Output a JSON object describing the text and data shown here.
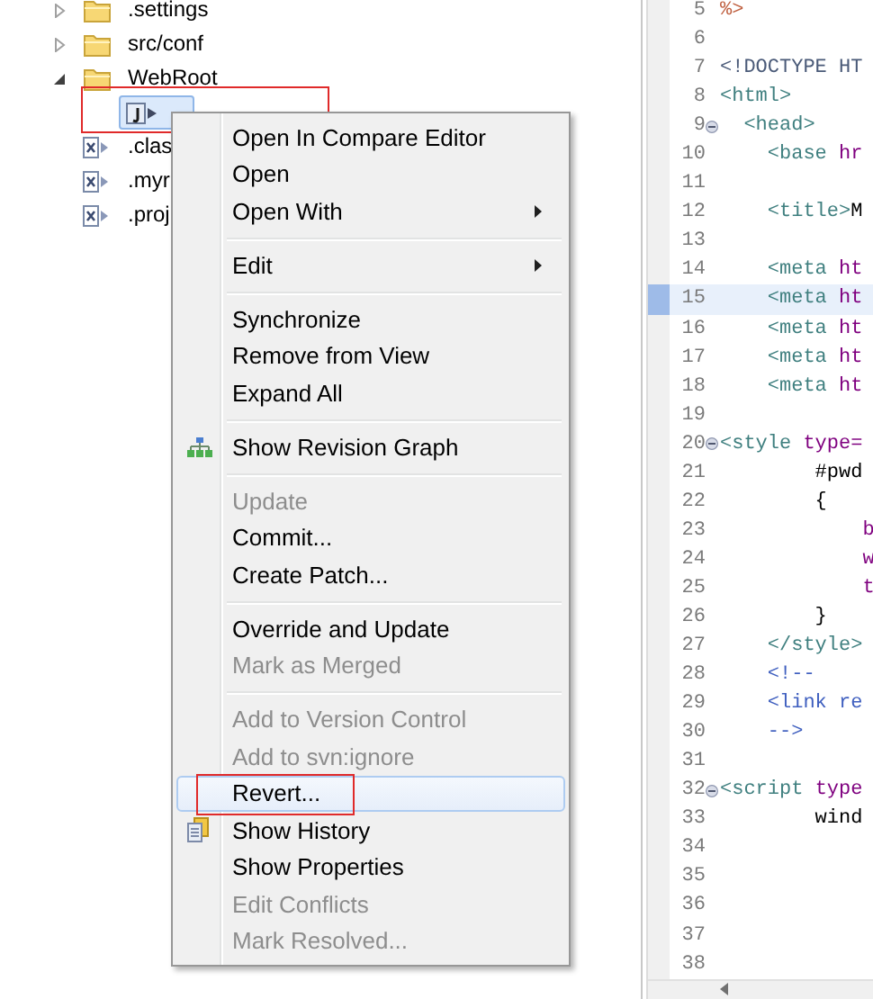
{
  "tree": {
    "items": [
      {
        "label": ".settings",
        "kind": "folder",
        "expanded": false,
        "selected": false
      },
      {
        "label": "src/conf",
        "kind": "folder",
        "expanded": false,
        "selected": false
      },
      {
        "label": "WebRoot",
        "kind": "folder",
        "expanded": true,
        "selected": false,
        "children": [
          {
            "kind": "jsp",
            "selected": true,
            "marked": true
          }
        ]
      },
      {
        "label": ".clas",
        "kind": "xml",
        "selected": false
      },
      {
        "label": ".myr",
        "kind": "xml",
        "selected": false
      },
      {
        "label": ".proj",
        "kind": "xml",
        "selected": false
      }
    ]
  },
  "context_menu": {
    "groups": [
      [
        {
          "label": "Open In Compare Editor",
          "kind": "plain",
          "disabled": false,
          "submenu": false,
          "highlighted": false,
          "marked": false
        },
        {
          "label": "Open",
          "kind": "plain",
          "disabled": false,
          "submenu": false,
          "highlighted": false,
          "marked": false
        },
        {
          "label": "Open With",
          "kind": "plain",
          "disabled": false,
          "submenu": true,
          "highlighted": false,
          "marked": false
        }
      ],
      [
        {
          "label": "Edit",
          "kind": "plain",
          "disabled": false,
          "submenu": true,
          "highlighted": false,
          "marked": false
        }
      ],
      [
        {
          "label": "Synchronize",
          "kind": "plain",
          "disabled": false,
          "submenu": false,
          "highlighted": false,
          "marked": false
        },
        {
          "label": "Remove from View",
          "kind": "plain",
          "disabled": false,
          "submenu": false,
          "highlighted": false,
          "marked": false
        },
        {
          "label": "Expand All",
          "kind": "plain",
          "disabled": false,
          "submenu": false,
          "highlighted": false,
          "marked": false
        }
      ],
      [
        {
          "label": "Show Revision Graph",
          "kind": "graph",
          "disabled": false,
          "submenu": false,
          "highlighted": false,
          "marked": false
        }
      ],
      [
        {
          "label": "Update",
          "kind": "plain",
          "disabled": true,
          "submenu": false,
          "highlighted": false,
          "marked": false
        },
        {
          "label": "Commit...",
          "kind": "plain",
          "disabled": false,
          "submenu": false,
          "highlighted": false,
          "marked": false
        },
        {
          "label": "Create Patch...",
          "kind": "plain",
          "disabled": false,
          "submenu": false,
          "highlighted": false,
          "marked": false
        }
      ],
      [
        {
          "label": "Override and Update",
          "kind": "plain",
          "disabled": false,
          "submenu": false,
          "highlighted": false,
          "marked": false
        },
        {
          "label": "Mark as Merged",
          "kind": "plain",
          "disabled": true,
          "submenu": false,
          "highlighted": false,
          "marked": false
        }
      ],
      [
        {
          "label": "Add to Version Control",
          "kind": "plain",
          "disabled": true,
          "submenu": false,
          "highlighted": false,
          "marked": false
        },
        {
          "label": "Add to svn:ignore",
          "kind": "plain",
          "disabled": true,
          "submenu": false,
          "highlighted": false,
          "marked": false
        },
        {
          "label": "Revert...",
          "kind": "plain",
          "disabled": false,
          "submenu": false,
          "highlighted": true,
          "marked": true
        },
        {
          "label": "Show History",
          "kind": "history",
          "disabled": false,
          "submenu": false,
          "highlighted": false,
          "marked": false
        },
        {
          "label": "Show Properties",
          "kind": "plain",
          "disabled": false,
          "submenu": false,
          "highlighted": false,
          "marked": false
        },
        {
          "label": "Edit Conflicts",
          "kind": "plain",
          "disabled": true,
          "submenu": false,
          "highlighted": false,
          "marked": false
        },
        {
          "label": "Mark Resolved...",
          "kind": "plain",
          "disabled": true,
          "submenu": false,
          "highlighted": false,
          "marked": false
        }
      ]
    ]
  },
  "editor": {
    "lines": [
      {
        "number": "5",
        "current": false,
        "foldable": false,
        "tokens": [
          {
            "text": "%>",
            "kind": "scriptlet"
          }
        ]
      },
      {
        "number": "6",
        "current": false,
        "foldable": false
      },
      {
        "number": "7",
        "current": false,
        "foldable": false,
        "tokens": [
          {
            "text": "<!DOCTYPE HT",
            "kind": "doctype"
          }
        ]
      },
      {
        "number": "8",
        "current": false,
        "foldable": false,
        "tokens": [
          {
            "text": "<html>",
            "kind": "tag"
          }
        ]
      },
      {
        "number": "9",
        "current": false,
        "foldable": true,
        "tokens": [
          {
            "text": "  <head>",
            "kind": "tag"
          }
        ]
      },
      {
        "number": "10",
        "current": false,
        "foldable": false,
        "tokens": [
          {
            "text": "    <base",
            "kind": "tag"
          },
          {
            "text": " hr",
            "kind": "attr"
          }
        ]
      },
      {
        "number": "11",
        "current": false,
        "foldable": false
      },
      {
        "number": "12",
        "current": false,
        "foldable": false,
        "tokens": [
          {
            "text": "    <title>",
            "kind": "tag"
          },
          {
            "text": "M",
            "kind": "plain"
          }
        ]
      },
      {
        "number": "13",
        "current": false,
        "foldable": false
      },
      {
        "number": "14",
        "current": false,
        "foldable": false,
        "tokens": [
          {
            "text": "    <meta",
            "kind": "tag"
          },
          {
            "text": " ht",
            "kind": "attr"
          }
        ]
      },
      {
        "number": "15",
        "current": true,
        "foldable": false,
        "tokens": [
          {
            "text": "    <meta",
            "kind": "tag"
          },
          {
            "text": " ht",
            "kind": "attr"
          }
        ]
      },
      {
        "number": "16",
        "current": false,
        "foldable": false,
        "tokens": [
          {
            "text": "    <meta",
            "kind": "tag"
          },
          {
            "text": " ht",
            "kind": "attr"
          }
        ]
      },
      {
        "number": "17",
        "current": false,
        "foldable": false,
        "tokens": [
          {
            "text": "    <meta",
            "kind": "tag"
          },
          {
            "text": " ht",
            "kind": "attr"
          }
        ]
      },
      {
        "number": "18",
        "current": false,
        "foldable": false,
        "tokens": [
          {
            "text": "    <meta",
            "kind": "tag"
          },
          {
            "text": " ht",
            "kind": "attr"
          }
        ]
      },
      {
        "number": "19",
        "current": false,
        "foldable": false
      },
      {
        "number": "20",
        "current": false,
        "foldable": true,
        "tokens": [
          {
            "text": "<style",
            "kind": "tag"
          },
          {
            "text": " type=",
            "kind": "attr"
          }
        ]
      },
      {
        "number": "21",
        "current": false,
        "foldable": false,
        "tokens": [
          {
            "text": "        #pwd",
            "kind": "plain"
          }
        ]
      },
      {
        "number": "22",
        "current": false,
        "foldable": false,
        "tokens": [
          {
            "text": "        {",
            "kind": "plain"
          }
        ]
      },
      {
        "number": "23",
        "current": false,
        "foldable": false,
        "tokens": [
          {
            "text": "            b",
            "kind": "attr"
          }
        ]
      },
      {
        "number": "24",
        "current": false,
        "foldable": false,
        "tokens": [
          {
            "text": "            w",
            "kind": "attr"
          }
        ]
      },
      {
        "number": "25",
        "current": false,
        "foldable": false,
        "tokens": [
          {
            "text": "            t",
            "kind": "attr"
          }
        ]
      },
      {
        "number": "26",
        "current": false,
        "foldable": false,
        "tokens": [
          {
            "text": "        }",
            "kind": "plain"
          }
        ]
      },
      {
        "number": "27",
        "current": false,
        "foldable": false,
        "tokens": [
          {
            "text": "    </style>",
            "kind": "tag"
          }
        ]
      },
      {
        "number": "28",
        "current": false,
        "foldable": false,
        "tokens": [
          {
            "text": "    <!--",
            "kind": "comment"
          }
        ]
      },
      {
        "number": "29",
        "current": false,
        "foldable": false,
        "tokens": [
          {
            "text": "    <link re",
            "kind": "comment"
          }
        ]
      },
      {
        "number": "30",
        "current": false,
        "foldable": false,
        "tokens": [
          {
            "text": "    -->",
            "kind": "comment"
          }
        ]
      },
      {
        "number": "31",
        "current": false,
        "foldable": false
      },
      {
        "number": "32",
        "current": false,
        "foldable": true,
        "tokens": [
          {
            "text": "<script",
            "kind": "tag"
          },
          {
            "text": " type",
            "kind": "attr"
          }
        ]
      },
      {
        "number": "33",
        "current": false,
        "foldable": false,
        "tokens": [
          {
            "text": "        wind",
            "kind": "plain"
          }
        ]
      },
      {
        "number": "34",
        "current": false,
        "foldable": false
      },
      {
        "number": "35",
        "current": false,
        "foldable": false
      },
      {
        "number": "36",
        "current": false,
        "foldable": false
      },
      {
        "number": "37",
        "current": false,
        "foldable": false
      },
      {
        "number": "38",
        "current": false,
        "foldable": false
      }
    ]
  }
}
